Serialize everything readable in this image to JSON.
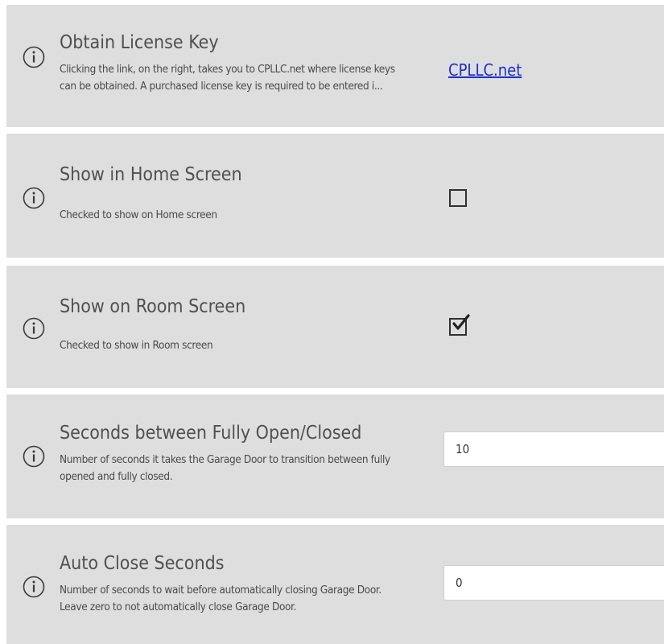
{
  "settings": {
    "license": {
      "title": "Obtain License Key",
      "desc_line1": "Clicking the link, on the right, takes you to CPLLC.net where license keys",
      "desc_line2": "can be obtained.  A purchased license key is required to be entered i...",
      "link_text": "CPLLC.net"
    },
    "home_screen": {
      "title": "Show in Home Screen",
      "desc": "Checked to show on Home screen",
      "checked": false
    },
    "room_screen": {
      "title": "Show on Room Screen",
      "desc": "Checked to show in Room screen",
      "checked": true
    },
    "open_closed": {
      "title": "Seconds between Fully Open/Closed",
      "desc_line1": "Number of seconds it takes the Garage Door to transition between fully",
      "desc_line2": "opened and fully closed.",
      "value": "10"
    },
    "auto_close": {
      "title": "Auto Close Seconds",
      "desc_line1": "Number of seconds to wait before automatically closing Garage Door.",
      "desc_line2": "Leave zero to not automatically close Garage Door.",
      "value": "0"
    }
  },
  "icons": {
    "info": "info-circle-icon",
    "check": "checkmark-icon"
  },
  "colors": {
    "row_background": "#dedede",
    "link": "#1a2fd0",
    "text": "#505050"
  }
}
